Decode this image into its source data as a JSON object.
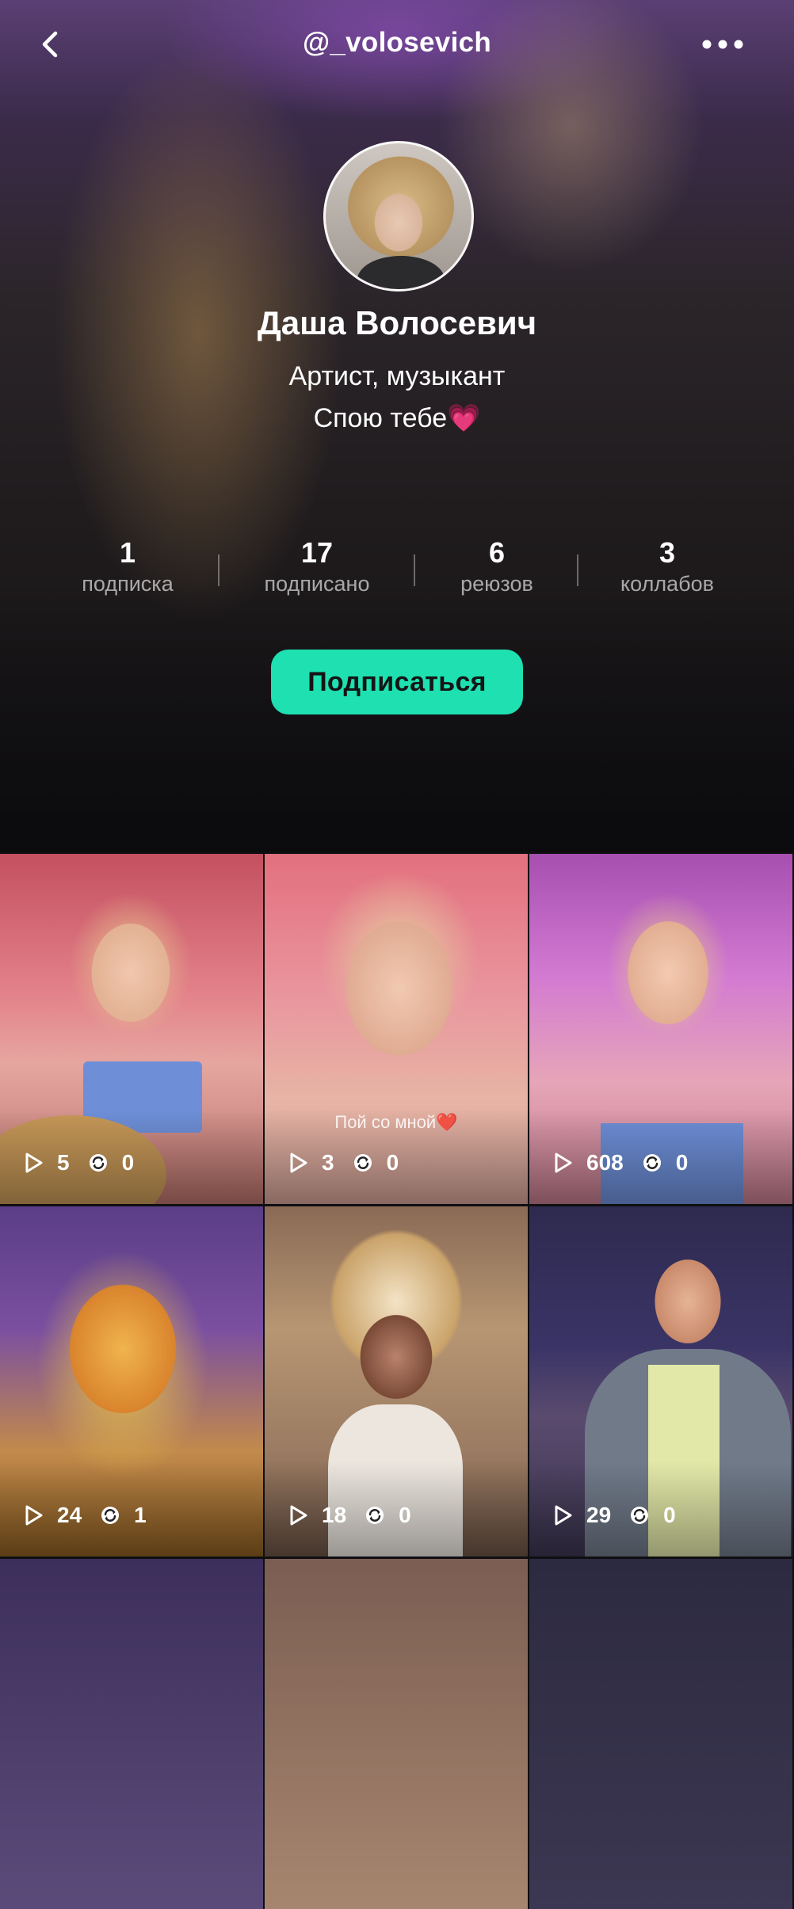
{
  "header": {
    "handle": "@_volosevich",
    "back_icon": "chevron-left-icon",
    "more_icon": "more-horizontal-icon"
  },
  "profile": {
    "name": "Даша Волосевич",
    "bio_line1": "Артист, музыкант",
    "bio_line2": "Спою тебе💗",
    "stats": [
      {
        "value": "1",
        "label": "подписка"
      },
      {
        "value": "17",
        "label": "подписано"
      },
      {
        "value": "6",
        "label": "реюзов"
      },
      {
        "value": "3",
        "label": "коллабов"
      }
    ],
    "subscribe_label": "Подписаться",
    "subscribe_color": "#1ee0b0"
  },
  "videos": [
    {
      "plays": "5",
      "reuses": "0",
      "caption": ""
    },
    {
      "plays": "3",
      "reuses": "0",
      "caption": "Пой со мной❤️"
    },
    {
      "plays": "608",
      "reuses": "0",
      "caption": ""
    },
    {
      "plays": "24",
      "reuses": "1",
      "caption": ""
    },
    {
      "plays": "18",
      "reuses": "0",
      "caption": ""
    },
    {
      "plays": "29",
      "reuses": "0",
      "caption": ""
    }
  ],
  "icons": {
    "play": "play-icon",
    "reuse": "repeat-icon"
  }
}
